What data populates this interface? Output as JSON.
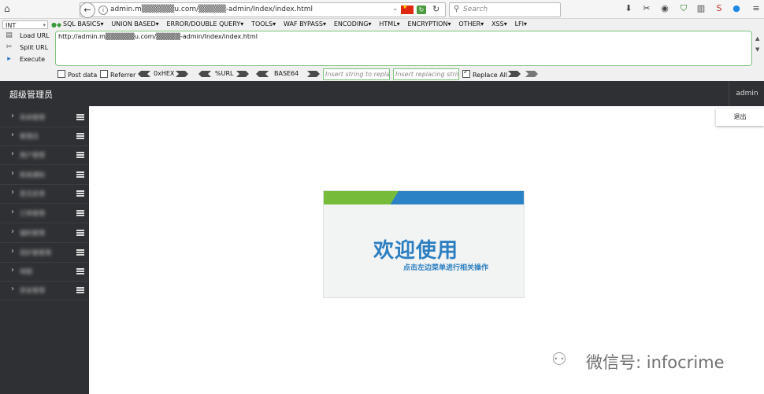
{
  "browser": {
    "url": "admin.m▒▒▒▒▒▒u.com/▒▒▒▒▒-admin/Index/index.html",
    "search_placeholder": "Search",
    "toolbar_icons": [
      "download-icon",
      "screenshot-icon",
      "mask-icon",
      "shield-icon",
      "sidebar-icon",
      "s-extension-icon",
      "account-icon",
      "menu-icon"
    ]
  },
  "hackbar": {
    "int_select": "INT",
    "menus": [
      "SQL BASICS▾",
      "UNION BASED▾",
      "ERROR/DOUBLE QUERY▾",
      "TOOLS▾",
      "WAF BYPASS▾",
      "ENCODING▾",
      "HTML▾",
      "ENCRYPTION▾",
      "OTHER▾",
      "XSS▾",
      "LFI▾"
    ],
    "actions": {
      "load": "Load URL",
      "split": "Split URL",
      "execute": "Execute"
    },
    "url_value": "http://admin.m▒▒▒▒▒▒u.com/▒▒▒▒▒-admin/Index/index.html",
    "post_data": "Post data",
    "referrer": "Referrer",
    "hex": "0xHEX",
    "urlenc": "%URL",
    "base64": "BASE64",
    "replace_placeholder": "Insert string to replace",
    "replacing_placeholder": "Insert replacing string",
    "replace_all": "Replace All",
    "replace_all_checked": true
  },
  "app": {
    "brand": "超级管理员",
    "user": "admin",
    "logout": "退出",
    "sidebar": [
      "系统管理",
      "管理员",
      "用户管理",
      "新闻通知",
      "意见反馈",
      "订单管理",
      "福利管理",
      "保护套管理",
      "地图",
      "资金管理"
    ],
    "welcome_title": "欢迎使用",
    "welcome_sub": "点击左边菜单进行相关操作"
  },
  "watermark": {
    "text": "微信号: infocrime"
  }
}
